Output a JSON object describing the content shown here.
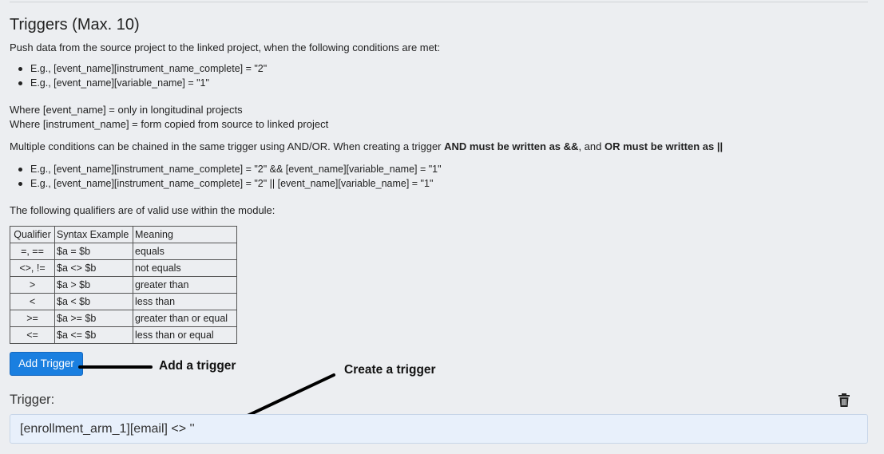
{
  "section": {
    "title": "Triggers (Max. 10)",
    "intro": "Push data from the source project to the linked project, when the following conditions are met:",
    "examples": [
      "E.g., [event_name][instrument_name_complete] = \"2\"",
      "E.g., [event_name][variable_name] = \"1\""
    ],
    "where_event": "Where [event_name] = only in longitudinal projects",
    "where_instrument": "Where [instrument_name] = form copied from source to linked project",
    "chain_text_1": "Multiple conditions can be chained in the same trigger using AND/OR. When creating a trigger ",
    "chain_bold_and": "AND must be written as &&",
    "chain_text_2": ", and ",
    "chain_bold_or": "OR must be written as ||",
    "chain_examples": [
      "E.g., [event_name][instrument_name_complete] = \"2\" && [event_name][variable_name] = \"1\"",
      "E.g., [event_name][instrument_name_complete] = \"2\" || [event_name][variable_name] = \"1\""
    ],
    "qualifiers_intro": "The following qualifiers are of valid use within the module:"
  },
  "qualifier_table": {
    "headers": [
      "Qualifier",
      "Syntax Example",
      "Meaning"
    ],
    "rows": [
      [
        "=, ==",
        "$a = $b",
        "equals"
      ],
      [
        "<>, !=",
        "$a <> $b",
        "not equals"
      ],
      [
        ">",
        "$a > $b",
        "greater than"
      ],
      [
        "<",
        "$a < $b",
        "less than"
      ],
      [
        ">=",
        "$a >= $b",
        "greater than or equal"
      ],
      [
        "<=",
        "$a <= $b",
        "less than or equal"
      ]
    ]
  },
  "add_trigger_button": "Add Trigger",
  "annotations": {
    "add": "Add a trigger",
    "create": "Create a trigger"
  },
  "trigger": {
    "label": "Trigger:",
    "value": "[enrollment_arm_1][email] <> ''",
    "delete_icon": "trash-icon"
  },
  "colors": {
    "background": "#eceef1",
    "button": "#1a7fe0",
    "input_bg": "#e8f0fb"
  }
}
